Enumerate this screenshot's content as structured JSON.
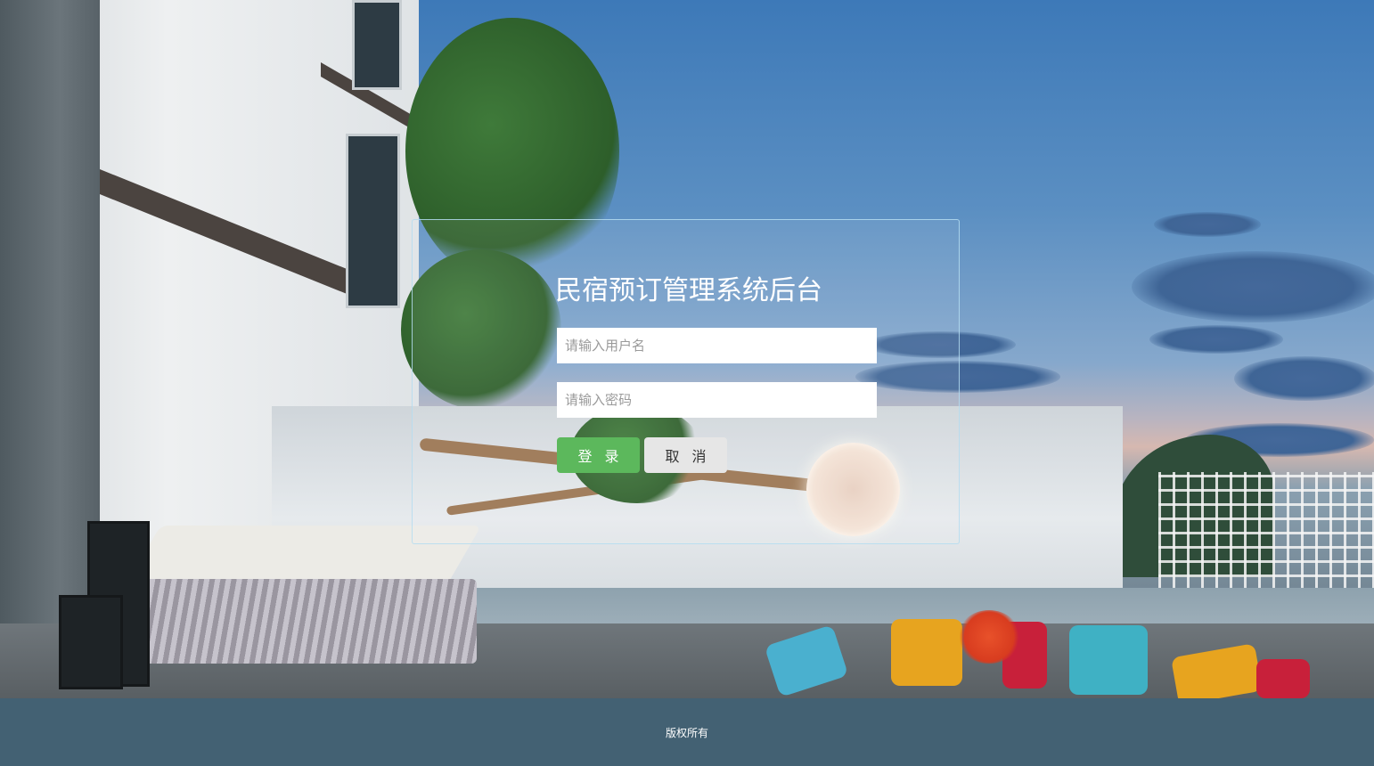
{
  "login": {
    "title": "民宿预订管理系统后台",
    "username_placeholder": "请输入用户名",
    "username_value": "",
    "password_placeholder": "请输入密码",
    "password_value": "",
    "login_button": "登录",
    "cancel_button": "取消"
  },
  "footer": {
    "copyright": "版权所有"
  },
  "colors": {
    "login_button": "#5cb85c",
    "cancel_button": "#e6e6e6",
    "footer_background": "#436173",
    "panel_border": "#b4dcf0"
  },
  "background": {
    "icon": "villa-background-photo"
  }
}
